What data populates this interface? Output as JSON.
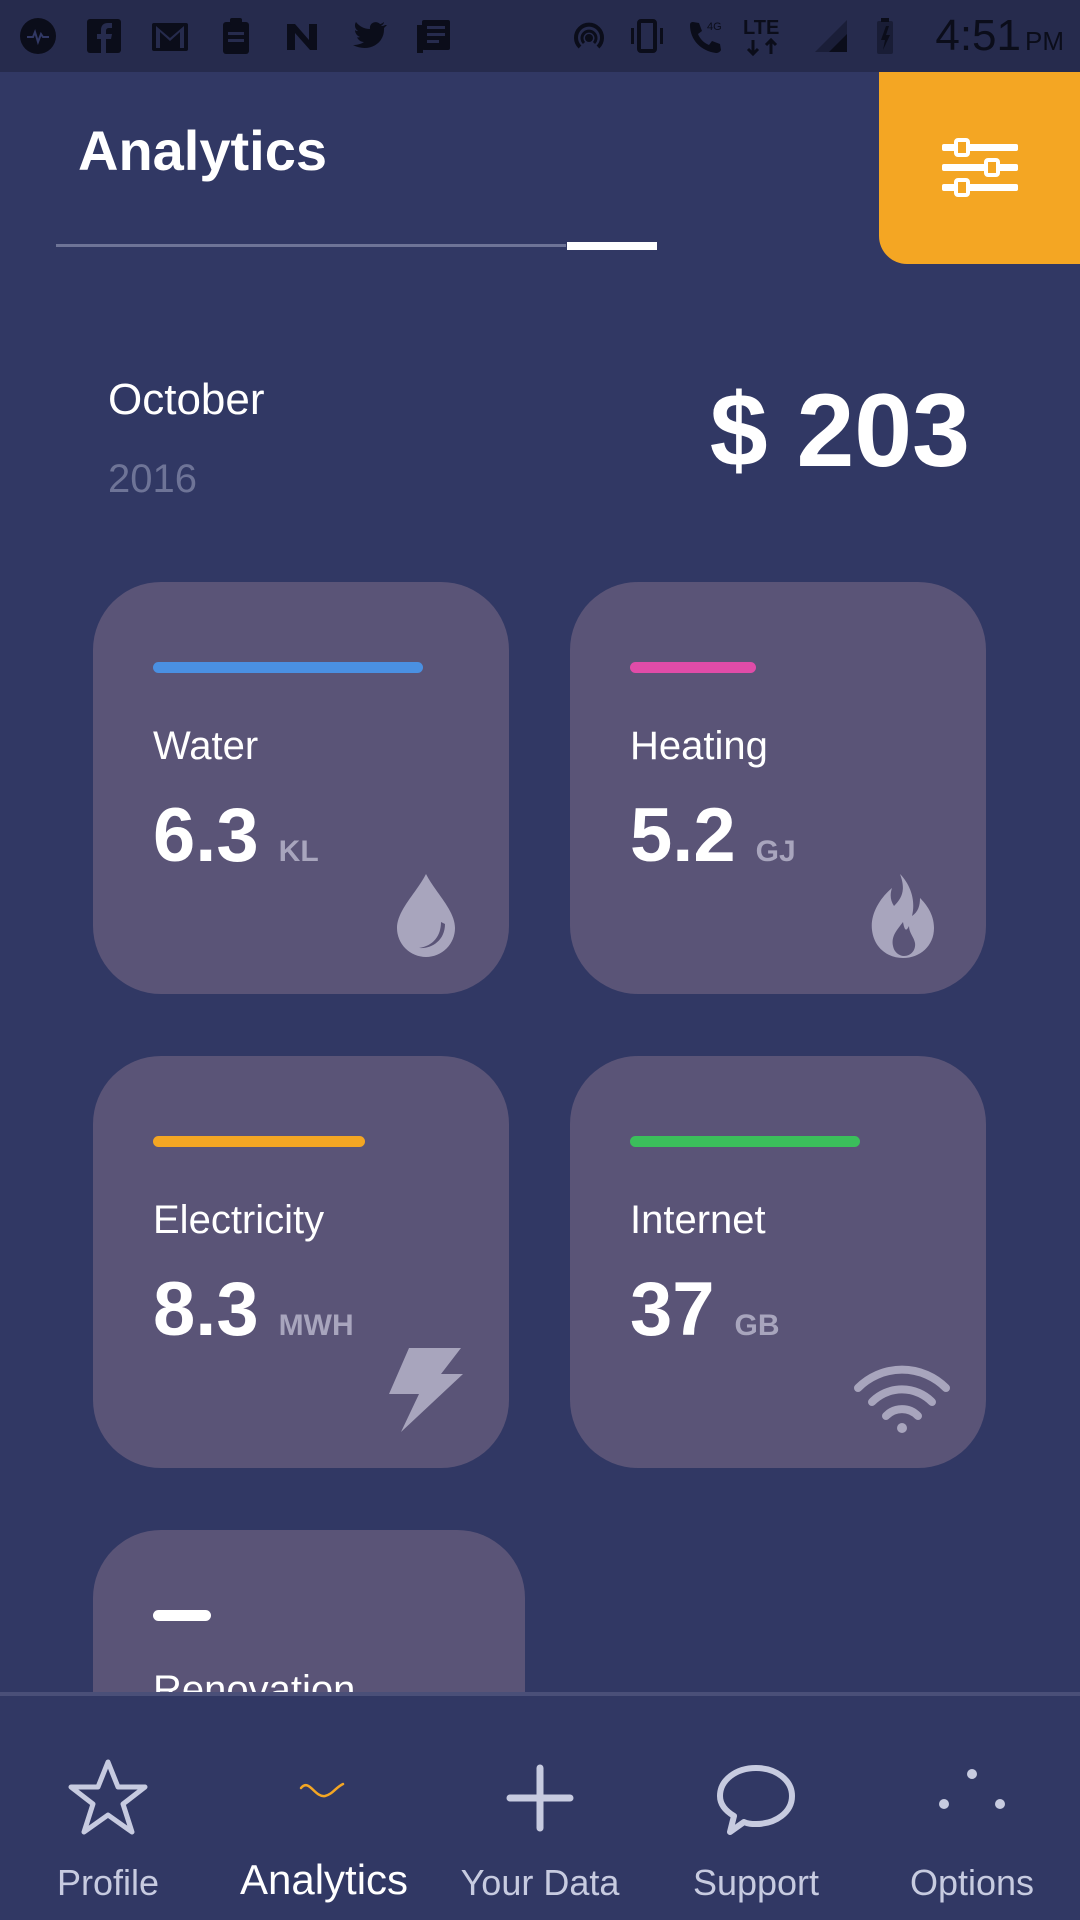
{
  "status_bar": {
    "time": "4:51",
    "ampm": "PM",
    "network": "LTE",
    "network_4g": "4G",
    "icons_left": [
      "app-icon",
      "facebook-icon",
      "gmail-icon",
      "clipboard-icon",
      "n-icon",
      "twitter-icon",
      "news-icon"
    ],
    "icons_right": [
      "hotspot-icon",
      "vibrate-icon",
      "wifi-call-icon",
      "lte-icon",
      "signal-icon",
      "battery-icon"
    ]
  },
  "header": {
    "title": "Analytics",
    "filter_icon": "sliders-icon",
    "accent_color": "#f4a623"
  },
  "period": {
    "month": "October",
    "year": "2016",
    "total": "$ 203"
  },
  "cards": [
    {
      "label": "Water",
      "value": "6.3",
      "unit": "KL",
      "icon": "water-drop-icon",
      "color": "#4a90e2",
      "bar_fraction": 0.75
    },
    {
      "label": "Heating",
      "value": "5.2",
      "unit": "GJ",
      "icon": "flame-icon",
      "color": "#e04ca8",
      "bar_fraction": 0.35
    },
    {
      "label": "Electricity",
      "value": "8.3",
      "unit": "MWH",
      "icon": "lightning-icon",
      "color": "#f4a623",
      "bar_fraction": 0.59
    },
    {
      "label": "Internet",
      "value": "37",
      "unit": "GB",
      "icon": "wifi-icon",
      "color": "#3bbf5b",
      "bar_fraction": 0.64
    },
    {
      "label": "Renovation",
      "color": "#ffffff",
      "bar_fraction": 0.16
    }
  ],
  "bottom_nav": [
    {
      "label": "Profile",
      "icon": "star-icon",
      "active": false
    },
    {
      "label": "Analytics",
      "icon": "wave-icon",
      "active": true
    },
    {
      "label": "Your Data",
      "icon": "plus-icon",
      "active": false
    },
    {
      "label": "Support",
      "icon": "chat-bubble-icon",
      "active": false
    },
    {
      "label": "Options",
      "icon": "dots-icon",
      "active": false
    }
  ]
}
